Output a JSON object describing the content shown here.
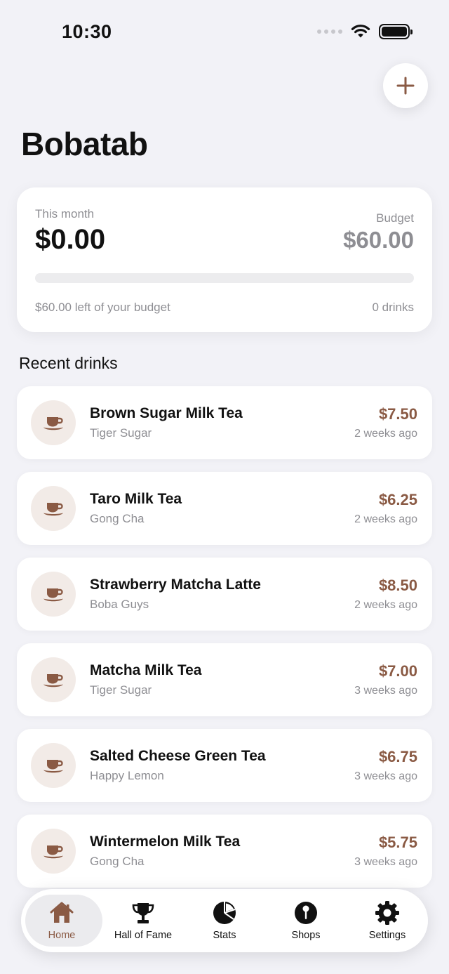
{
  "status": {
    "time": "10:30"
  },
  "header": {
    "title": "Bobatab",
    "add_icon": "plus-icon"
  },
  "summary": {
    "month_label": "This month",
    "month_total": "$0.00",
    "budget_label": "Budget",
    "budget_value": "$60.00",
    "progress_fraction": 0,
    "left_text": "$60.00 left of your budget",
    "drinks_count": "0 drinks"
  },
  "recent": {
    "title": "Recent drinks",
    "items": [
      {
        "name": "Brown Sugar Milk Tea",
        "shop": "Tiger Sugar",
        "price": "$7.50",
        "time": "2 weeks ago"
      },
      {
        "name": "Taro Milk Tea",
        "shop": "Gong Cha",
        "price": "$6.25",
        "time": "2 weeks ago"
      },
      {
        "name": "Strawberry Matcha Latte",
        "shop": "Boba Guys",
        "price": "$8.50",
        "time": "2 weeks ago"
      },
      {
        "name": "Matcha Milk Tea",
        "shop": "Tiger Sugar",
        "price": "$7.00",
        "time": "3 weeks ago"
      },
      {
        "name": "Salted Cheese Green Tea",
        "shop": "Happy Lemon",
        "price": "$6.75",
        "time": "3 weeks ago"
      },
      {
        "name": "Wintermelon Milk Tea",
        "shop": "Gong Cha",
        "price": "$5.75",
        "time": "3 weeks ago"
      }
    ]
  },
  "tabs": [
    {
      "label": "Home",
      "icon": "house-icon",
      "active": true
    },
    {
      "label": "Hall of Fame",
      "icon": "trophy-icon",
      "active": false
    },
    {
      "label": "Stats",
      "icon": "pie-chart-icon",
      "active": false
    },
    {
      "label": "Shops",
      "icon": "map-pin-icon",
      "active": false
    },
    {
      "label": "Settings",
      "icon": "gear-icon",
      "active": false
    }
  ],
  "colors": {
    "accent": "#8a5a44",
    "background": "#f2f2f7",
    "muted": "#8e8e93"
  }
}
